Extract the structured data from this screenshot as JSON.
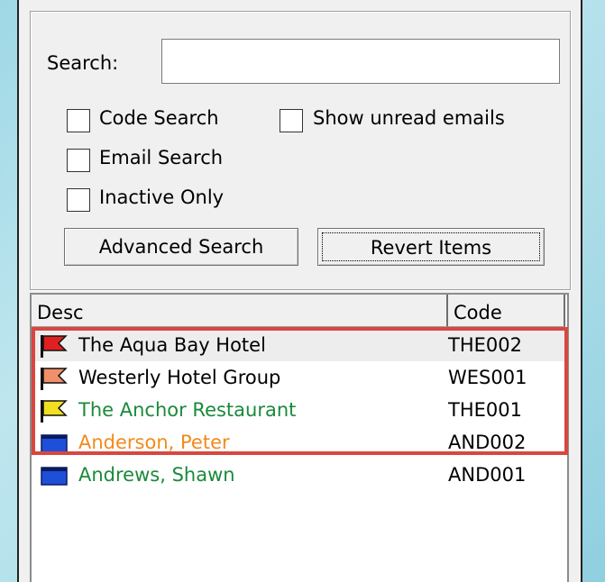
{
  "search": {
    "label": "Search:",
    "value": "",
    "placeholder": ""
  },
  "checkboxes": {
    "code_search": "Code Search",
    "show_unread": "Show unread emails",
    "email_search": "Email Search",
    "inactive_only": "Inactive Only"
  },
  "buttons": {
    "advanced_search": "Advanced Search",
    "revert_items": "Revert Items"
  },
  "list": {
    "columns": {
      "desc": "Desc",
      "code": "Code"
    },
    "rows": [
      {
        "desc": "The Aqua Bay Hotel",
        "code": "THE002",
        "color": "#000000",
        "icon": "red-flag-icon",
        "icon_color": "#e02020"
      },
      {
        "desc": "Westerly Hotel Group",
        "code": "WES001",
        "color": "#000000",
        "icon": "orange-flag-icon",
        "icon_color": "#f0906a"
      },
      {
        "desc": "The Anchor Restaurant",
        "code": "THE001",
        "color": "#1a8a3a",
        "icon": "yellow-flag-icon",
        "icon_color": "#f0e020"
      },
      {
        "desc": "Anderson, Peter",
        "code": "AND002",
        "color": "#f28a1a",
        "icon": "blue-folder-icon",
        "icon_color": "#1e4fd8"
      },
      {
        "desc": "Andrews, Shawn",
        "code": "AND001",
        "color": "#1a8a3a",
        "icon": "blue-folder-icon",
        "icon_color": "#1e4fd8"
      }
    ]
  },
  "highlight_color": "#d9463f"
}
